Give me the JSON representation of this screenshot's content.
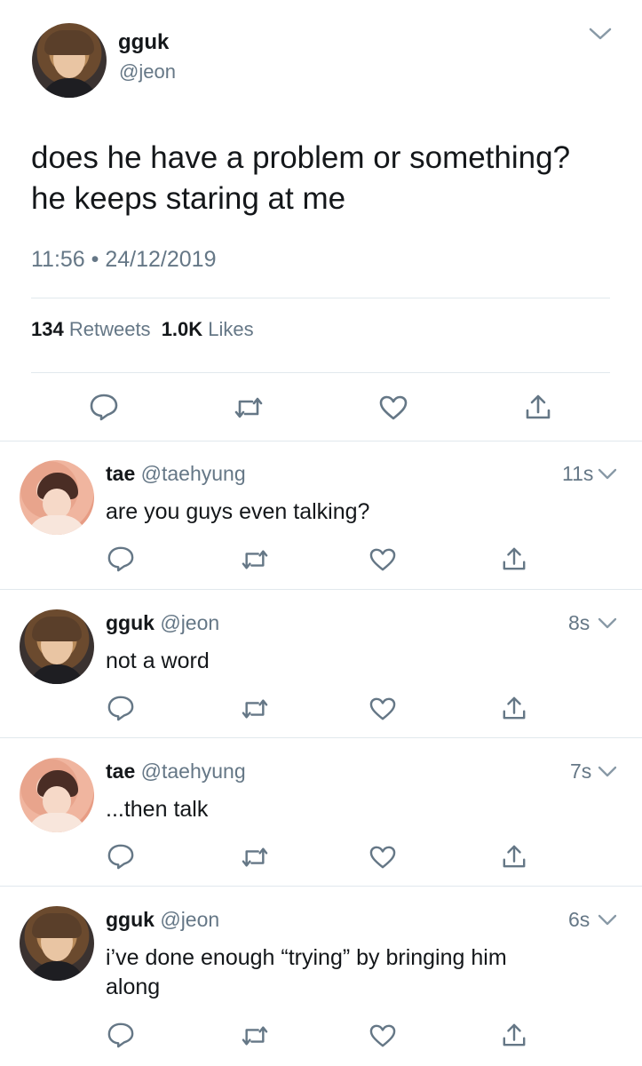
{
  "main_tweet": {
    "author_name": "gguk",
    "author_handle": "@jeon",
    "text_line1": "does he have a problem or something?",
    "text_line2": "he keeps staring at me",
    "timestamp": "11:56 • 24/12/2019",
    "retweet_count": "134",
    "retweet_label": "Retweets",
    "like_count": "1.0K",
    "like_label": "Likes"
  },
  "replies": [
    {
      "name": "tae",
      "handle": "@taehyung",
      "time": "11s",
      "text": "are you guys even talking?",
      "avatar": "tae"
    },
    {
      "name": "gguk",
      "handle": "@jeon",
      "time": "8s",
      "text": "not a word",
      "avatar": "gguk"
    },
    {
      "name": "tae",
      "handle": "@taehyung",
      "time": "7s",
      "text": "...then talk",
      "avatar": "tae"
    },
    {
      "name": "gguk",
      "handle": "@jeon",
      "time": "6s",
      "text": "i’ve done enough “trying” by bringing him",
      "text2": "along",
      "avatar": "gguk"
    }
  ],
  "colors": {
    "text": "#14171a",
    "secondary": "#657786",
    "divider": "#e1e8ed",
    "icon": "#657786"
  }
}
